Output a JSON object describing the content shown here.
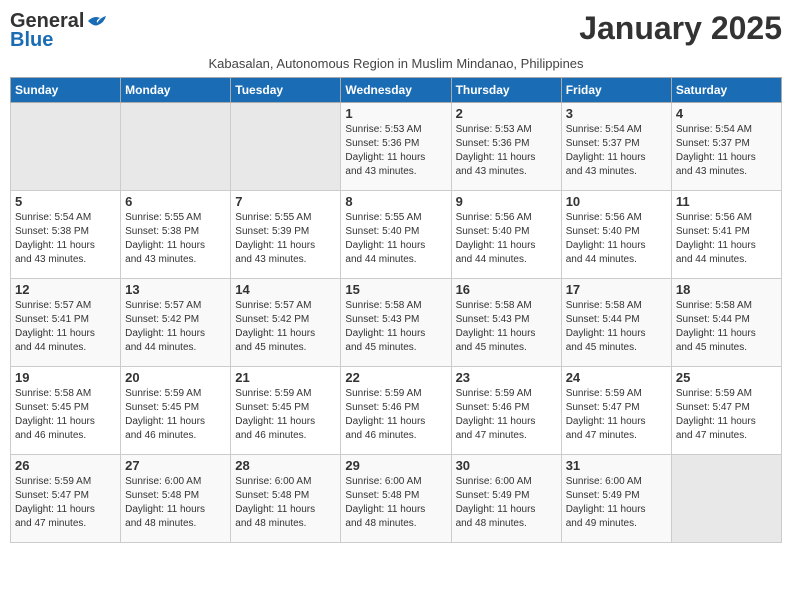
{
  "logo": {
    "general": "General",
    "blue": "Blue"
  },
  "title": "January 2025",
  "subtitle": "Kabasalan, Autonomous Region in Muslim Mindanao, Philippines",
  "days_header": [
    "Sunday",
    "Monday",
    "Tuesday",
    "Wednesday",
    "Thursday",
    "Friday",
    "Saturday"
  ],
  "weeks": [
    [
      {
        "day": "",
        "content": ""
      },
      {
        "day": "",
        "content": ""
      },
      {
        "day": "",
        "content": ""
      },
      {
        "day": "1",
        "content": "Sunrise: 5:53 AM\nSunset: 5:36 PM\nDaylight: 11 hours\nand 43 minutes."
      },
      {
        "day": "2",
        "content": "Sunrise: 5:53 AM\nSunset: 5:36 PM\nDaylight: 11 hours\nand 43 minutes."
      },
      {
        "day": "3",
        "content": "Sunrise: 5:54 AM\nSunset: 5:37 PM\nDaylight: 11 hours\nand 43 minutes."
      },
      {
        "day": "4",
        "content": "Sunrise: 5:54 AM\nSunset: 5:37 PM\nDaylight: 11 hours\nand 43 minutes."
      }
    ],
    [
      {
        "day": "5",
        "content": "Sunrise: 5:54 AM\nSunset: 5:38 PM\nDaylight: 11 hours\nand 43 minutes."
      },
      {
        "day": "6",
        "content": "Sunrise: 5:55 AM\nSunset: 5:38 PM\nDaylight: 11 hours\nand 43 minutes."
      },
      {
        "day": "7",
        "content": "Sunrise: 5:55 AM\nSunset: 5:39 PM\nDaylight: 11 hours\nand 43 minutes."
      },
      {
        "day": "8",
        "content": "Sunrise: 5:55 AM\nSunset: 5:40 PM\nDaylight: 11 hours\nand 44 minutes."
      },
      {
        "day": "9",
        "content": "Sunrise: 5:56 AM\nSunset: 5:40 PM\nDaylight: 11 hours\nand 44 minutes."
      },
      {
        "day": "10",
        "content": "Sunrise: 5:56 AM\nSunset: 5:40 PM\nDaylight: 11 hours\nand 44 minutes."
      },
      {
        "day": "11",
        "content": "Sunrise: 5:56 AM\nSunset: 5:41 PM\nDaylight: 11 hours\nand 44 minutes."
      }
    ],
    [
      {
        "day": "12",
        "content": "Sunrise: 5:57 AM\nSunset: 5:41 PM\nDaylight: 11 hours\nand 44 minutes."
      },
      {
        "day": "13",
        "content": "Sunrise: 5:57 AM\nSunset: 5:42 PM\nDaylight: 11 hours\nand 44 minutes."
      },
      {
        "day": "14",
        "content": "Sunrise: 5:57 AM\nSunset: 5:42 PM\nDaylight: 11 hours\nand 45 minutes."
      },
      {
        "day": "15",
        "content": "Sunrise: 5:58 AM\nSunset: 5:43 PM\nDaylight: 11 hours\nand 45 minutes."
      },
      {
        "day": "16",
        "content": "Sunrise: 5:58 AM\nSunset: 5:43 PM\nDaylight: 11 hours\nand 45 minutes."
      },
      {
        "day": "17",
        "content": "Sunrise: 5:58 AM\nSunset: 5:44 PM\nDaylight: 11 hours\nand 45 minutes."
      },
      {
        "day": "18",
        "content": "Sunrise: 5:58 AM\nSunset: 5:44 PM\nDaylight: 11 hours\nand 45 minutes."
      }
    ],
    [
      {
        "day": "19",
        "content": "Sunrise: 5:58 AM\nSunset: 5:45 PM\nDaylight: 11 hours\nand 46 minutes."
      },
      {
        "day": "20",
        "content": "Sunrise: 5:59 AM\nSunset: 5:45 PM\nDaylight: 11 hours\nand 46 minutes."
      },
      {
        "day": "21",
        "content": "Sunrise: 5:59 AM\nSunset: 5:45 PM\nDaylight: 11 hours\nand 46 minutes."
      },
      {
        "day": "22",
        "content": "Sunrise: 5:59 AM\nSunset: 5:46 PM\nDaylight: 11 hours\nand 46 minutes."
      },
      {
        "day": "23",
        "content": "Sunrise: 5:59 AM\nSunset: 5:46 PM\nDaylight: 11 hours\nand 47 minutes."
      },
      {
        "day": "24",
        "content": "Sunrise: 5:59 AM\nSunset: 5:47 PM\nDaylight: 11 hours\nand 47 minutes."
      },
      {
        "day": "25",
        "content": "Sunrise: 5:59 AM\nSunset: 5:47 PM\nDaylight: 11 hours\nand 47 minutes."
      }
    ],
    [
      {
        "day": "26",
        "content": "Sunrise: 5:59 AM\nSunset: 5:47 PM\nDaylight: 11 hours\nand 47 minutes."
      },
      {
        "day": "27",
        "content": "Sunrise: 6:00 AM\nSunset: 5:48 PM\nDaylight: 11 hours\nand 48 minutes."
      },
      {
        "day": "28",
        "content": "Sunrise: 6:00 AM\nSunset: 5:48 PM\nDaylight: 11 hours\nand 48 minutes."
      },
      {
        "day": "29",
        "content": "Sunrise: 6:00 AM\nSunset: 5:48 PM\nDaylight: 11 hours\nand 48 minutes."
      },
      {
        "day": "30",
        "content": "Sunrise: 6:00 AM\nSunset: 5:49 PM\nDaylight: 11 hours\nand 48 minutes."
      },
      {
        "day": "31",
        "content": "Sunrise: 6:00 AM\nSunset: 5:49 PM\nDaylight: 11 hours\nand 49 minutes."
      },
      {
        "day": "",
        "content": ""
      }
    ]
  ]
}
